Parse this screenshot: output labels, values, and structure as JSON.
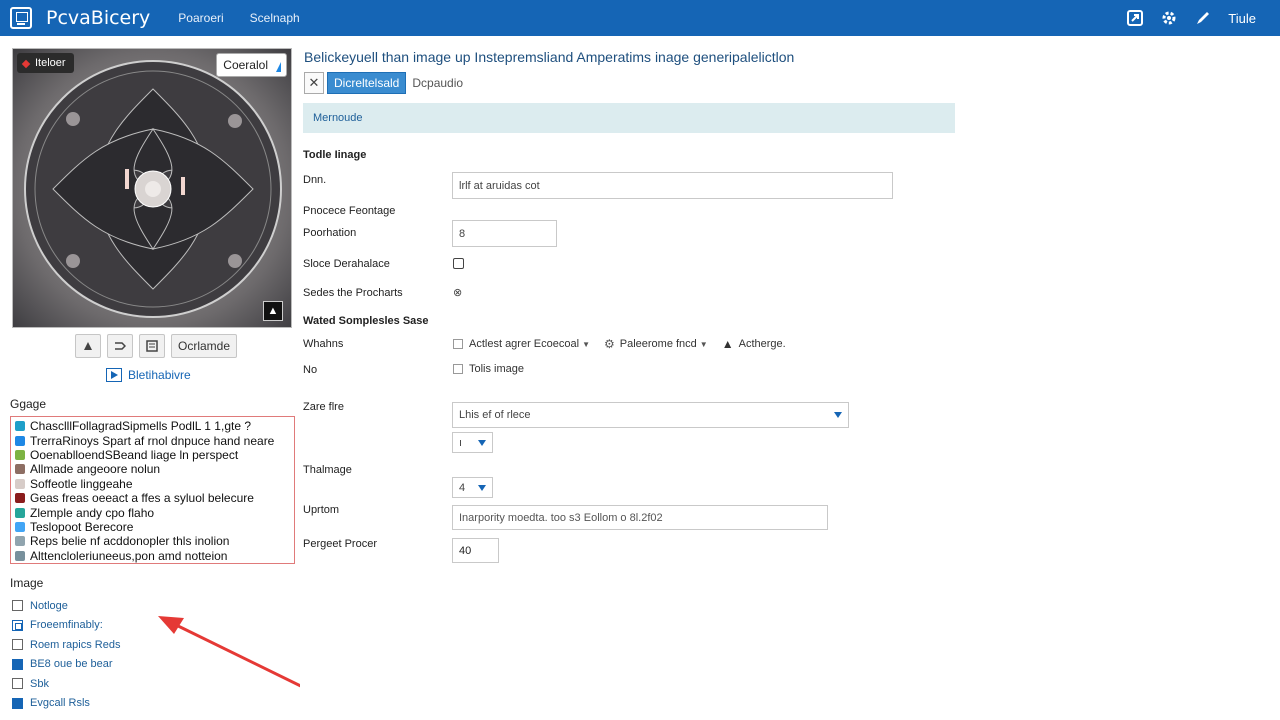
{
  "header": {
    "app_title": "PcvaBicery",
    "nav": [
      "Poaroeri",
      "Scelnaph"
    ],
    "user": "Tiule"
  },
  "preview": {
    "badge_left": "Iteloer",
    "badge_right": "Coeralol"
  },
  "toolbar": {
    "button_label": "Ocrlamde"
  },
  "link": {
    "label": "Bletihabivre"
  },
  "list_section": {
    "label": "Ggage",
    "items": [
      {
        "text": "ChasclllFollagradSipmells PodlL 1 1,gte ?",
        "color": "#1e9fc9"
      },
      {
        "text": "TrerraRinoys Spart af rnol dnpuce hand neare",
        "color": "#1e88e5"
      },
      {
        "text": "OoenablloendSBeand liage ln perspect",
        "color": "#7cb342"
      },
      {
        "text": "Allmade angeoore nolun",
        "color": "#8d6e63"
      },
      {
        "text": "Soffeotle linggeahe",
        "color": "#d7ccc8"
      },
      {
        "text": "Geas freas  oeeact a ffes a syluol belecure",
        "color": "#8b1d1d"
      },
      {
        "text": "Zlemple andy cpo flaho",
        "color": "#26a69a"
      },
      {
        "text": "Teslopoot Berecore",
        "color": "#42a5f5"
      },
      {
        "text": "Reps belie nf acddonopler thls inolion",
        "color": "#90a4ae"
      },
      {
        "text": "Alttencloleriuneeus,pon amd notteion",
        "color": "#78909c"
      }
    ]
  },
  "image_section": {
    "label": "Image",
    "items": [
      {
        "text": "Notloge",
        "state": "empty"
      },
      {
        "text": "Froeemfinably:",
        "state": "checked"
      },
      {
        "text": "Roem rapics Reds",
        "state": "empty"
      },
      {
        "text": "BE8 oue be bear",
        "state": "filled"
      },
      {
        "text": "Sbk",
        "state": "empty"
      },
      {
        "text": "Evgcall Rsls",
        "state": "filled"
      }
    ]
  },
  "main": {
    "heading": "Belickeyuell than image up Instepremsliand Amperatims inage generipalelictlon",
    "chip_x": "✕",
    "chip_active": "Dicreltelsald",
    "chip_plain": "Dcpaudio",
    "banner": "Mernoude",
    "section1": "Todle Iinage",
    "row1_label": "Dnn.",
    "row1_value": "lrlf at aruidas cot",
    "section2": "Pnocece Feontage",
    "row2_label": "Poorhation",
    "row2_value": "8",
    "row3_label": "Sloce Derahalace",
    "row4_label": "Sedes the Procharts",
    "row4_icon": "⊗",
    "section3": "Wated Somplesles Sase",
    "row5_label": "Whahns",
    "row5_opt1": "Actlest agrer Ecoecoal",
    "row5_opt2": "Paleerome fncd",
    "row5_opt3": "Actherge.",
    "row6_label": "No",
    "row6_opt": "Tolis image",
    "row7_label": "Zare flre",
    "row7_value": "Lhis ef of rlece",
    "row7b_value": "ı",
    "row8_label": "Thalmage",
    "row8_value": "4",
    "row9_label": "Uprtom",
    "row9_value": "Inarpority moedta. too s3 Eollom o 8l.2f02",
    "row10_label": "Pergeet Procer",
    "row10_value": "40"
  }
}
